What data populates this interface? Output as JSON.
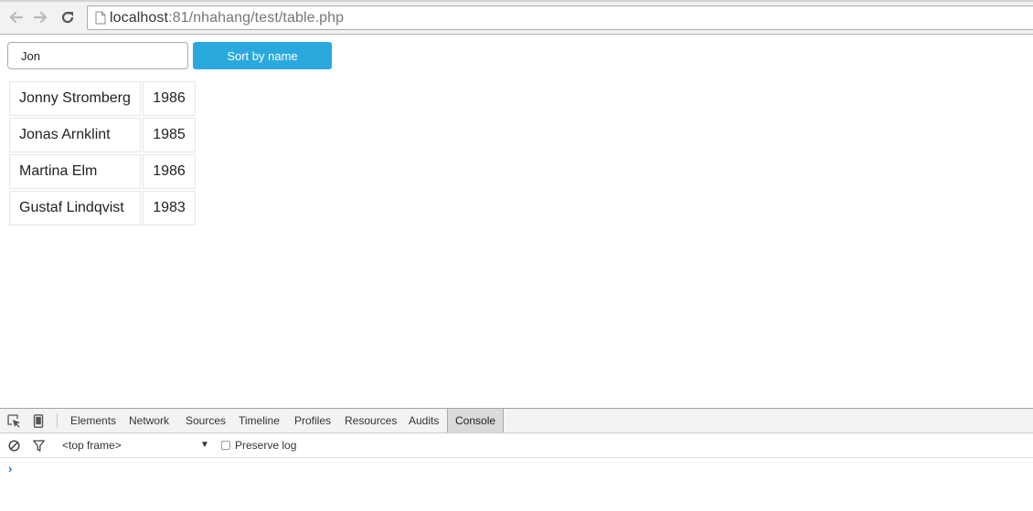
{
  "browser": {
    "url_host": "localhost",
    "url_rest": ":81/nhahang/test/table.php"
  },
  "page": {
    "search": {
      "value": "Jon",
      "placeholder": ""
    },
    "sort_button_label": "Sort by name",
    "table": {
      "rows": [
        {
          "name": "Jonny Stromberg",
          "year": "1986"
        },
        {
          "name": "Jonas Arnklint",
          "year": "1985"
        },
        {
          "name": "Martina Elm",
          "year": "1986"
        },
        {
          "name": "Gustaf Lindqvist",
          "year": "1983"
        }
      ]
    }
  },
  "devtools": {
    "tabs": [
      "Elements",
      "Network",
      "Sources",
      "Timeline",
      "Profiles",
      "Resources",
      "Audits",
      "Console"
    ],
    "active_tab": "Console",
    "frame_selector": "<top frame>",
    "preserve_log_label": "Preserve log",
    "preserve_log_checked": false,
    "prompt": "›"
  },
  "colors": {
    "accent": "#2aa9df",
    "prompt": "#2b6fd6"
  },
  "icons": [
    "back-arrow-icon",
    "forward-arrow-icon",
    "reload-icon",
    "page-icon",
    "inspect-icon",
    "device-icon",
    "clear-console-icon",
    "filter-icon"
  ]
}
